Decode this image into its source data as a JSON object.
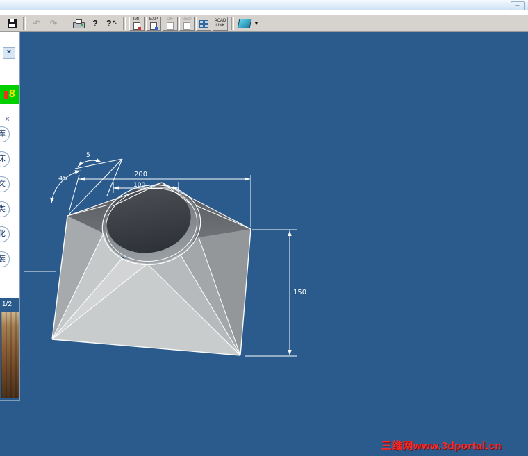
{
  "window": {
    "minimize_label": "–"
  },
  "toolbar": {
    "undo_icon": "↶",
    "redo_icon": "↷",
    "help_icon": "?",
    "context_help_icon": "?",
    "context_help_cursor": "↖",
    "dropdown_icon": "▼",
    "io_buttons": [
      {
        "label": "IMP"
      },
      {
        "label": "EXP"
      },
      {
        "label": "DIF"
      },
      {
        "label": "GEO"
      }
    ],
    "acad_link_line1": "ACAD",
    "acad_link_line2": "LINK"
  },
  "sidebar": {
    "close_icon": "×",
    "panel_close_icon": "×",
    "badge_text": "8",
    "category_buttons": [
      {
        "label": "库"
      },
      {
        "label": "床"
      },
      {
        "label": "文"
      },
      {
        "label": "类"
      },
      {
        "label": "化"
      },
      {
        "label": "装"
      }
    ],
    "page_indicator": "1/2"
  },
  "viewport": {
    "dimensions": {
      "top_width": "200",
      "hole_diameter": "100",
      "height": "150",
      "angle": "45",
      "small_angle": "5"
    }
  },
  "watermark": {
    "text": "三维网www.3dportal.cn"
  },
  "colors": {
    "viewport_bg": "#2a5b8c",
    "badge_green": "#00cf00",
    "watermark_red": "#ff2a2a"
  }
}
